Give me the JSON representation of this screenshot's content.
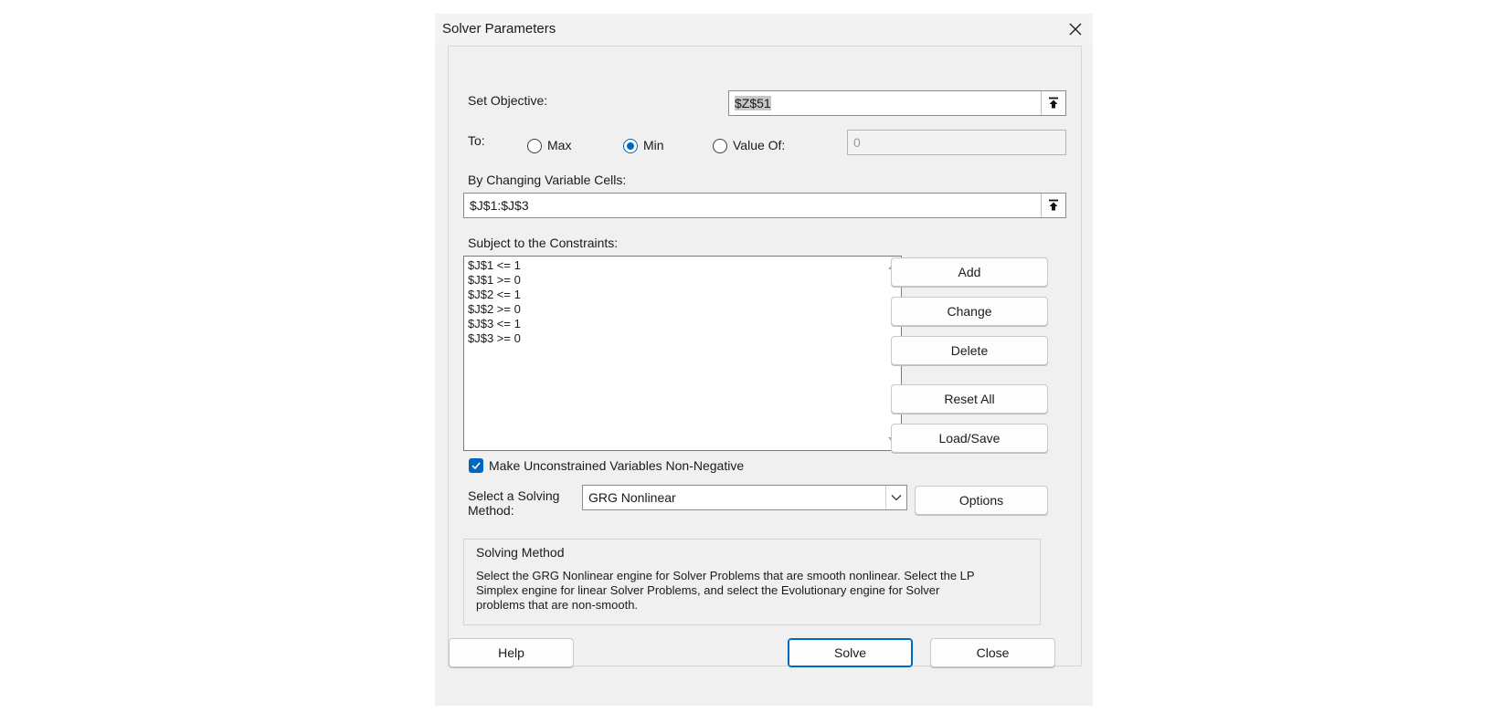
{
  "window": {
    "title": "Solver Parameters"
  },
  "objective": {
    "label": "Set Objective:",
    "value": "$Z$51"
  },
  "to": {
    "label": "To:",
    "max_label": "Max",
    "min_label": "Min",
    "value_of_label": "Value Of:",
    "selected": "Min",
    "value_of": "0"
  },
  "variables": {
    "label": "By Changing Variable Cells:",
    "value": "$J$1:$J$3"
  },
  "constraints": {
    "label": "Subject to the Constraints:",
    "items": [
      "$J$1 <= 1",
      "$J$1 >= 0",
      "$J$2 <= 1",
      "$J$2 >= 0",
      "$J$3 <= 1",
      "$J$3 >= 0"
    ]
  },
  "buttons": {
    "add": "Add",
    "change": "Change",
    "delete": "Delete",
    "reset_all": "Reset All",
    "load_save": "Load/Save",
    "options": "Options",
    "help": "Help",
    "solve": "Solve",
    "close": "Close"
  },
  "nonneg": {
    "label": "Make Unconstrained Variables Non-Negative",
    "checked": true
  },
  "method": {
    "label_line1": "Select a Solving",
    "label_line2": "Method:",
    "value": "GRG Nonlinear"
  },
  "solving_method": {
    "title": "Solving Method",
    "line1": "Select the GRG Nonlinear engine for Solver Problems that are smooth nonlinear. Select the LP",
    "line2": "Simplex engine for linear Solver Problems, and select the Evolutionary engine for Solver",
    "line3": "problems that are non-smooth."
  },
  "colors": {
    "accent": "#0067c0",
    "dialog_bg": "#f0f0f0"
  },
  "icons": [
    "close-icon",
    "collapse-arrow-icon",
    "scroll-up-icon",
    "scroll-down-icon",
    "checkmark-icon",
    "chevron-down-icon"
  ]
}
